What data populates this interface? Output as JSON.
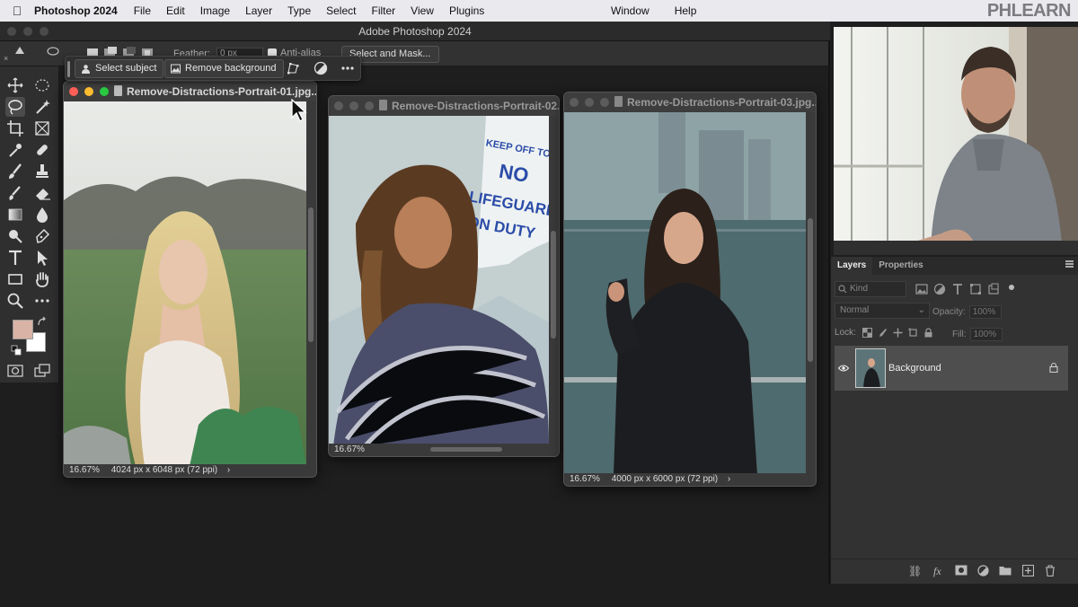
{
  "menubar": {
    "app": "Photoshop 2024",
    "items": [
      "File",
      "Edit",
      "Image",
      "Layer",
      "Type",
      "Select",
      "Filter",
      "View",
      "Plugins"
    ],
    "right_items": [
      "Window",
      "Help"
    ],
    "brand": "PHLEARN"
  },
  "window": {
    "title": "Adobe Photoshop 2024"
  },
  "options_bar": {
    "feather_label": "Feather:",
    "feather_value": "0 px",
    "anti_alias_label": "Anti-alias",
    "select_and_mask": "Select and Mask..."
  },
  "task_bar": {
    "select_subject": "Select subject",
    "remove_background": "Remove background"
  },
  "documents": [
    {
      "title": "Remove-Distractions-Portrait-01.jpg...",
      "zoom": "16.67%",
      "info": "4024 px x 6048 px (72 ppi)"
    },
    {
      "title": "Remove-Distractions-Portrait-02...",
      "zoom": "16.67%",
      "info": ""
    },
    {
      "title": "Remove-Distractions-Portrait-03.jpg...",
      "zoom": "16.67%",
      "info": "4000 px x 6000 px (72 ppi)"
    }
  ],
  "sign_text": {
    "line1": "KEEP OFF TOWER",
    "line2": "NO",
    "line3": "LIFEGUARD",
    "line4": "ON DUTY"
  },
  "layers_panel": {
    "tabs": [
      "Layers",
      "Properties"
    ],
    "kind_label": "Kind",
    "blend_mode": "Normal",
    "opacity_label": "Opacity:",
    "opacity_value": "100%",
    "lock_label": "Lock:",
    "fill_label": "Fill:",
    "fill_value": "100%",
    "layer_name": "Background"
  },
  "colors": {
    "foreground": "#d8b3a6",
    "background": "#ffffff",
    "panel": "#323232",
    "workspace": "#1e1e1e"
  },
  "icons": [
    "apple-icon",
    "move-icon",
    "lasso-icon",
    "crop-icon",
    "eyedropper-icon",
    "brush-icon",
    "eraser-icon",
    "gradient-icon",
    "pen-icon",
    "type-icon",
    "hand-icon",
    "zoom-icon",
    "eye-icon",
    "lock-icon",
    "link-icon",
    "fx-icon",
    "mask-icon",
    "adjustment-icon",
    "folder-icon",
    "new-layer-icon",
    "trash-icon"
  ]
}
